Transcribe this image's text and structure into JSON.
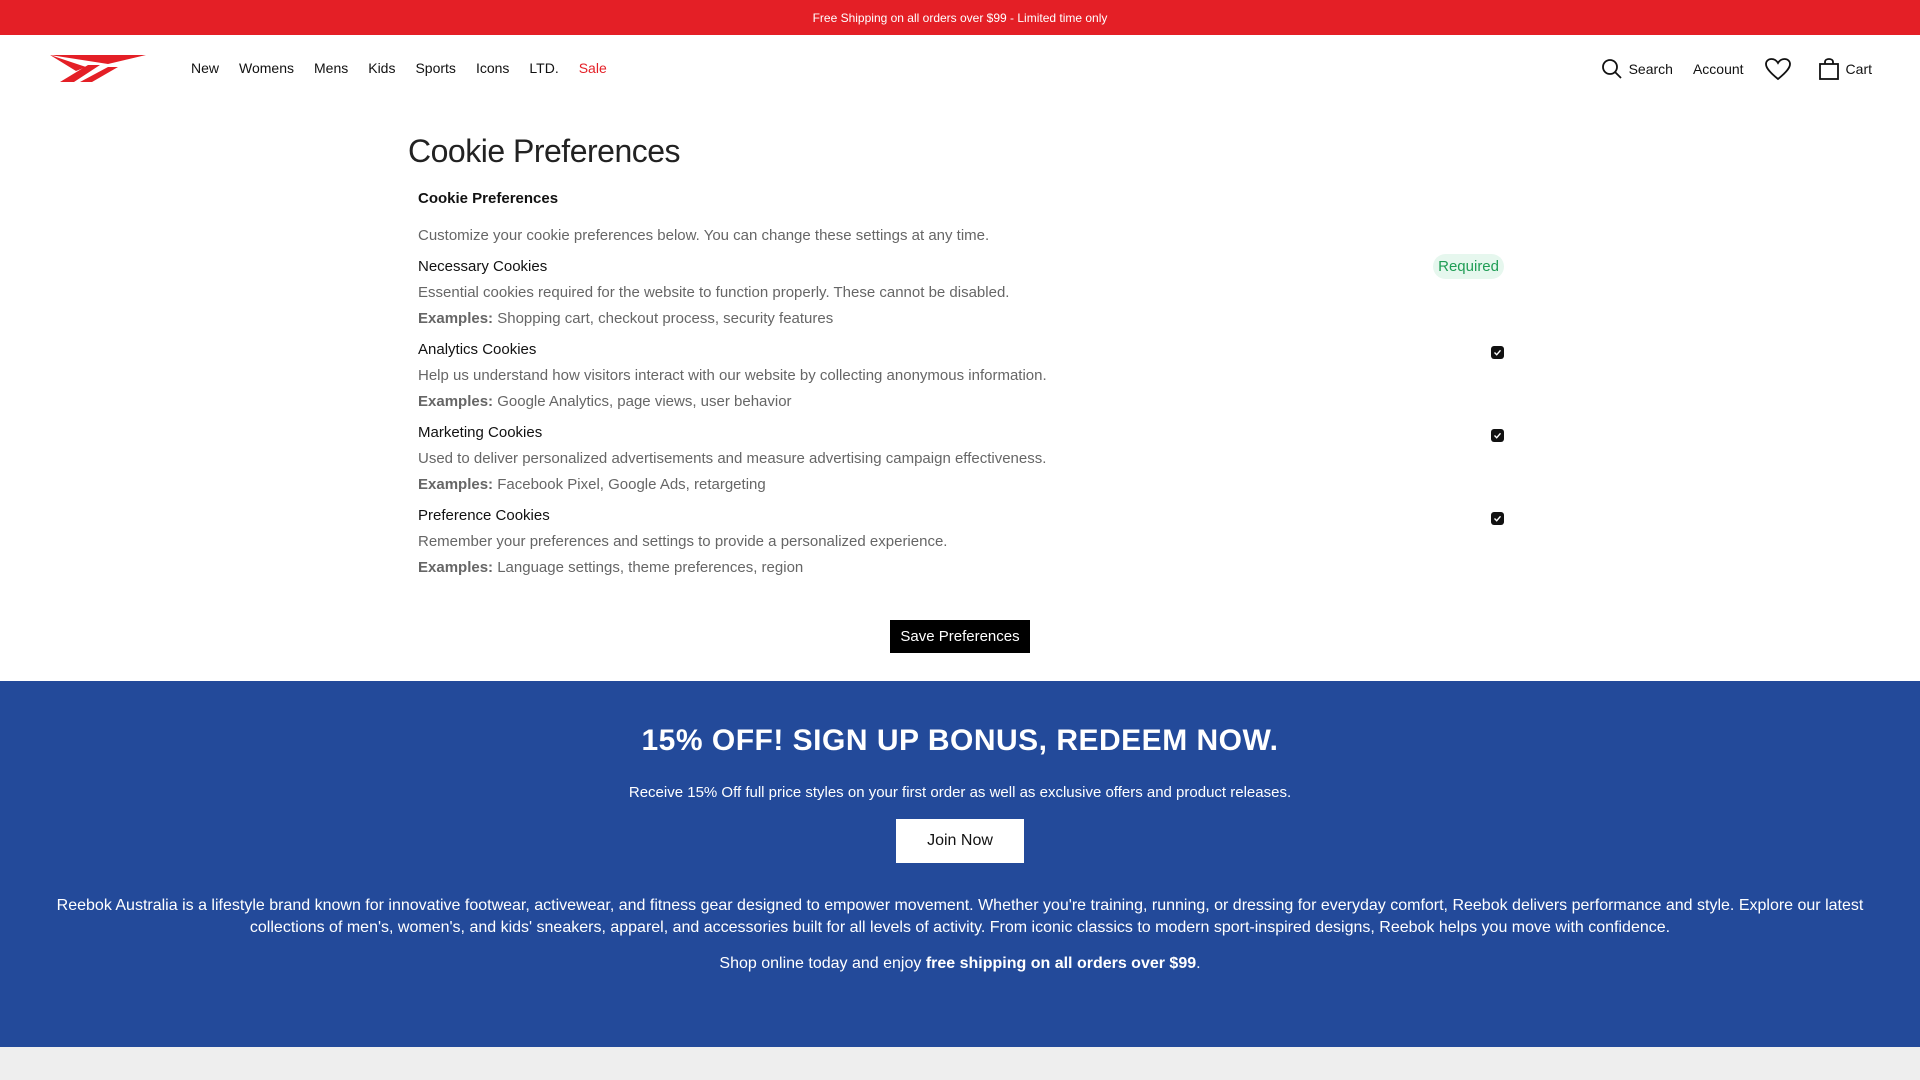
{
  "promo": {
    "text": "Free Shipping on all orders over $99 - Limited time only"
  },
  "nav": {
    "items": [
      {
        "label": "New"
      },
      {
        "label": "Womens"
      },
      {
        "label": "Mens"
      },
      {
        "label": "Kids"
      },
      {
        "label": "Sports"
      },
      {
        "label": "Icons"
      },
      {
        "label": "LTD."
      },
      {
        "label": "Sale"
      }
    ]
  },
  "utilities": {
    "search": "Search",
    "account": "Account",
    "cart": "Cart"
  },
  "page": {
    "title": "Cookie Preferences"
  },
  "panel": {
    "title": "Cookie Preferences",
    "intro": "Customize your cookie preferences below. You can change these settings at any time.",
    "examples_label": "Examples:",
    "cookies": [
      {
        "name": "Necessary Cookies",
        "description": "Essential cookies required for the website to function properly. These cannot be disabled.",
        "examples": "Shopping cart, checkout process, security features",
        "badge": "Required"
      },
      {
        "name": "Analytics Cookies",
        "description": "Help us understand how visitors interact with our website by collecting anonymous information.",
        "examples": "Google Analytics, page views, user behavior",
        "checked": true
      },
      {
        "name": "Marketing Cookies",
        "description": "Used to deliver personalized advertisements and measure advertising campaign effectiveness.",
        "examples": "Facebook Pixel, Google Ads, retargeting",
        "checked": true
      },
      {
        "name": "Preference Cookies",
        "description": "Remember your preferences and settings to provide a personalized experience.",
        "examples": "Language settings, theme preferences, region",
        "checked": true
      }
    ],
    "save_label": "Save Preferences"
  },
  "signup": {
    "heading": "15% OFF! SIGN UP BONUS, REDEEM NOW.",
    "subtext": "Receive 15% Off full price styles on your first order as well as exclusive offers and product releases.",
    "join_label": "Join Now",
    "about": "Reebok Australia is a lifestyle brand known for innovative footwear, activewear, and fitness gear designed to empower movement. Whether you're training, running, or dressing for everyday comfort, Reebok delivers performance and style. Explore our latest collections of men's, women's, and kids' sneakers, apparel, and accessories built for all levels of activity. From iconic classics to modern sport-inspired designs, Reebok helps you move with confidence.",
    "shipping_prefix": "Shop online today and enjoy ",
    "shipping_bold": "free shipping on all orders over $99",
    "shipping_suffix": "."
  },
  "colors": {
    "promo_red": "#e41f26",
    "signup_blue": "#234a9a",
    "badge_green": "#1f9d55"
  },
  "icons": [
    "reebok-logo-icon",
    "search-icon",
    "heart-icon",
    "bag-icon",
    "check-icon"
  ]
}
